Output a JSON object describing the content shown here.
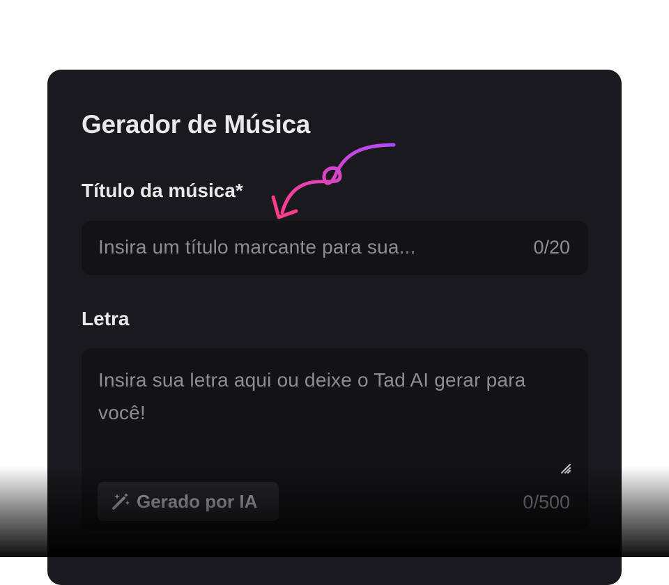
{
  "form": {
    "heading": "Gerador de Música",
    "title_field": {
      "label": "Título da música*",
      "placeholder": "Insira um título marcante para sua...",
      "counter": "0/20"
    },
    "lyrics_field": {
      "label": "Letra",
      "placeholder": "Insira sua letra aqui ou deixe o Tad AI gerar para você!",
      "counter": "0/500",
      "ai_button_label": "Gerado por IA"
    }
  },
  "icons": {
    "arrow": "curly-arrow-icon",
    "wand": "magic-wand-icon",
    "resize": "resize-handle-icon"
  },
  "colors": {
    "card_bg": "#1a1a1e",
    "field_bg": "#131316",
    "arrow_start": "#ff3d8b",
    "arrow_end": "#b14bff"
  }
}
